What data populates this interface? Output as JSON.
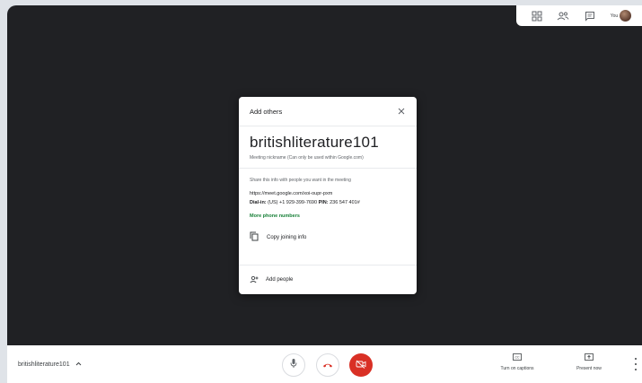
{
  "topbar": {
    "you_label": "You",
    "icons": [
      "grid-view-icon",
      "people-icon",
      "chat-icon"
    ]
  },
  "dialog": {
    "title": "Add others",
    "close_icon": "close-icon",
    "meeting_nickname": "britishliterature101",
    "nickname_note": "Meeting nickname (Can only be used within Google.com)",
    "share_text": "Share this info with people you want in the meeting",
    "meeting_link": "https://meet.google.com/xoi-oupr-pxm",
    "dial_in_label": "Dial-in:",
    "dial_in_value": "(US) +1 929-399-7690",
    "pin_label": "PIN:",
    "pin_value": "236 547 401#",
    "more_phone_numbers": "More phone numbers",
    "copy_joining_info": "Copy joining info",
    "add_people": "Add people"
  },
  "bottombar": {
    "meeting_name": "britishliterature101",
    "captions_label": "Turn on captions",
    "present_label": "Present now",
    "colors": {
      "hangup_icon": "#d93025",
      "camera_off_button": "#d93025"
    }
  },
  "colors": {
    "accent_green": "#188038",
    "stage_background": "#202124"
  }
}
